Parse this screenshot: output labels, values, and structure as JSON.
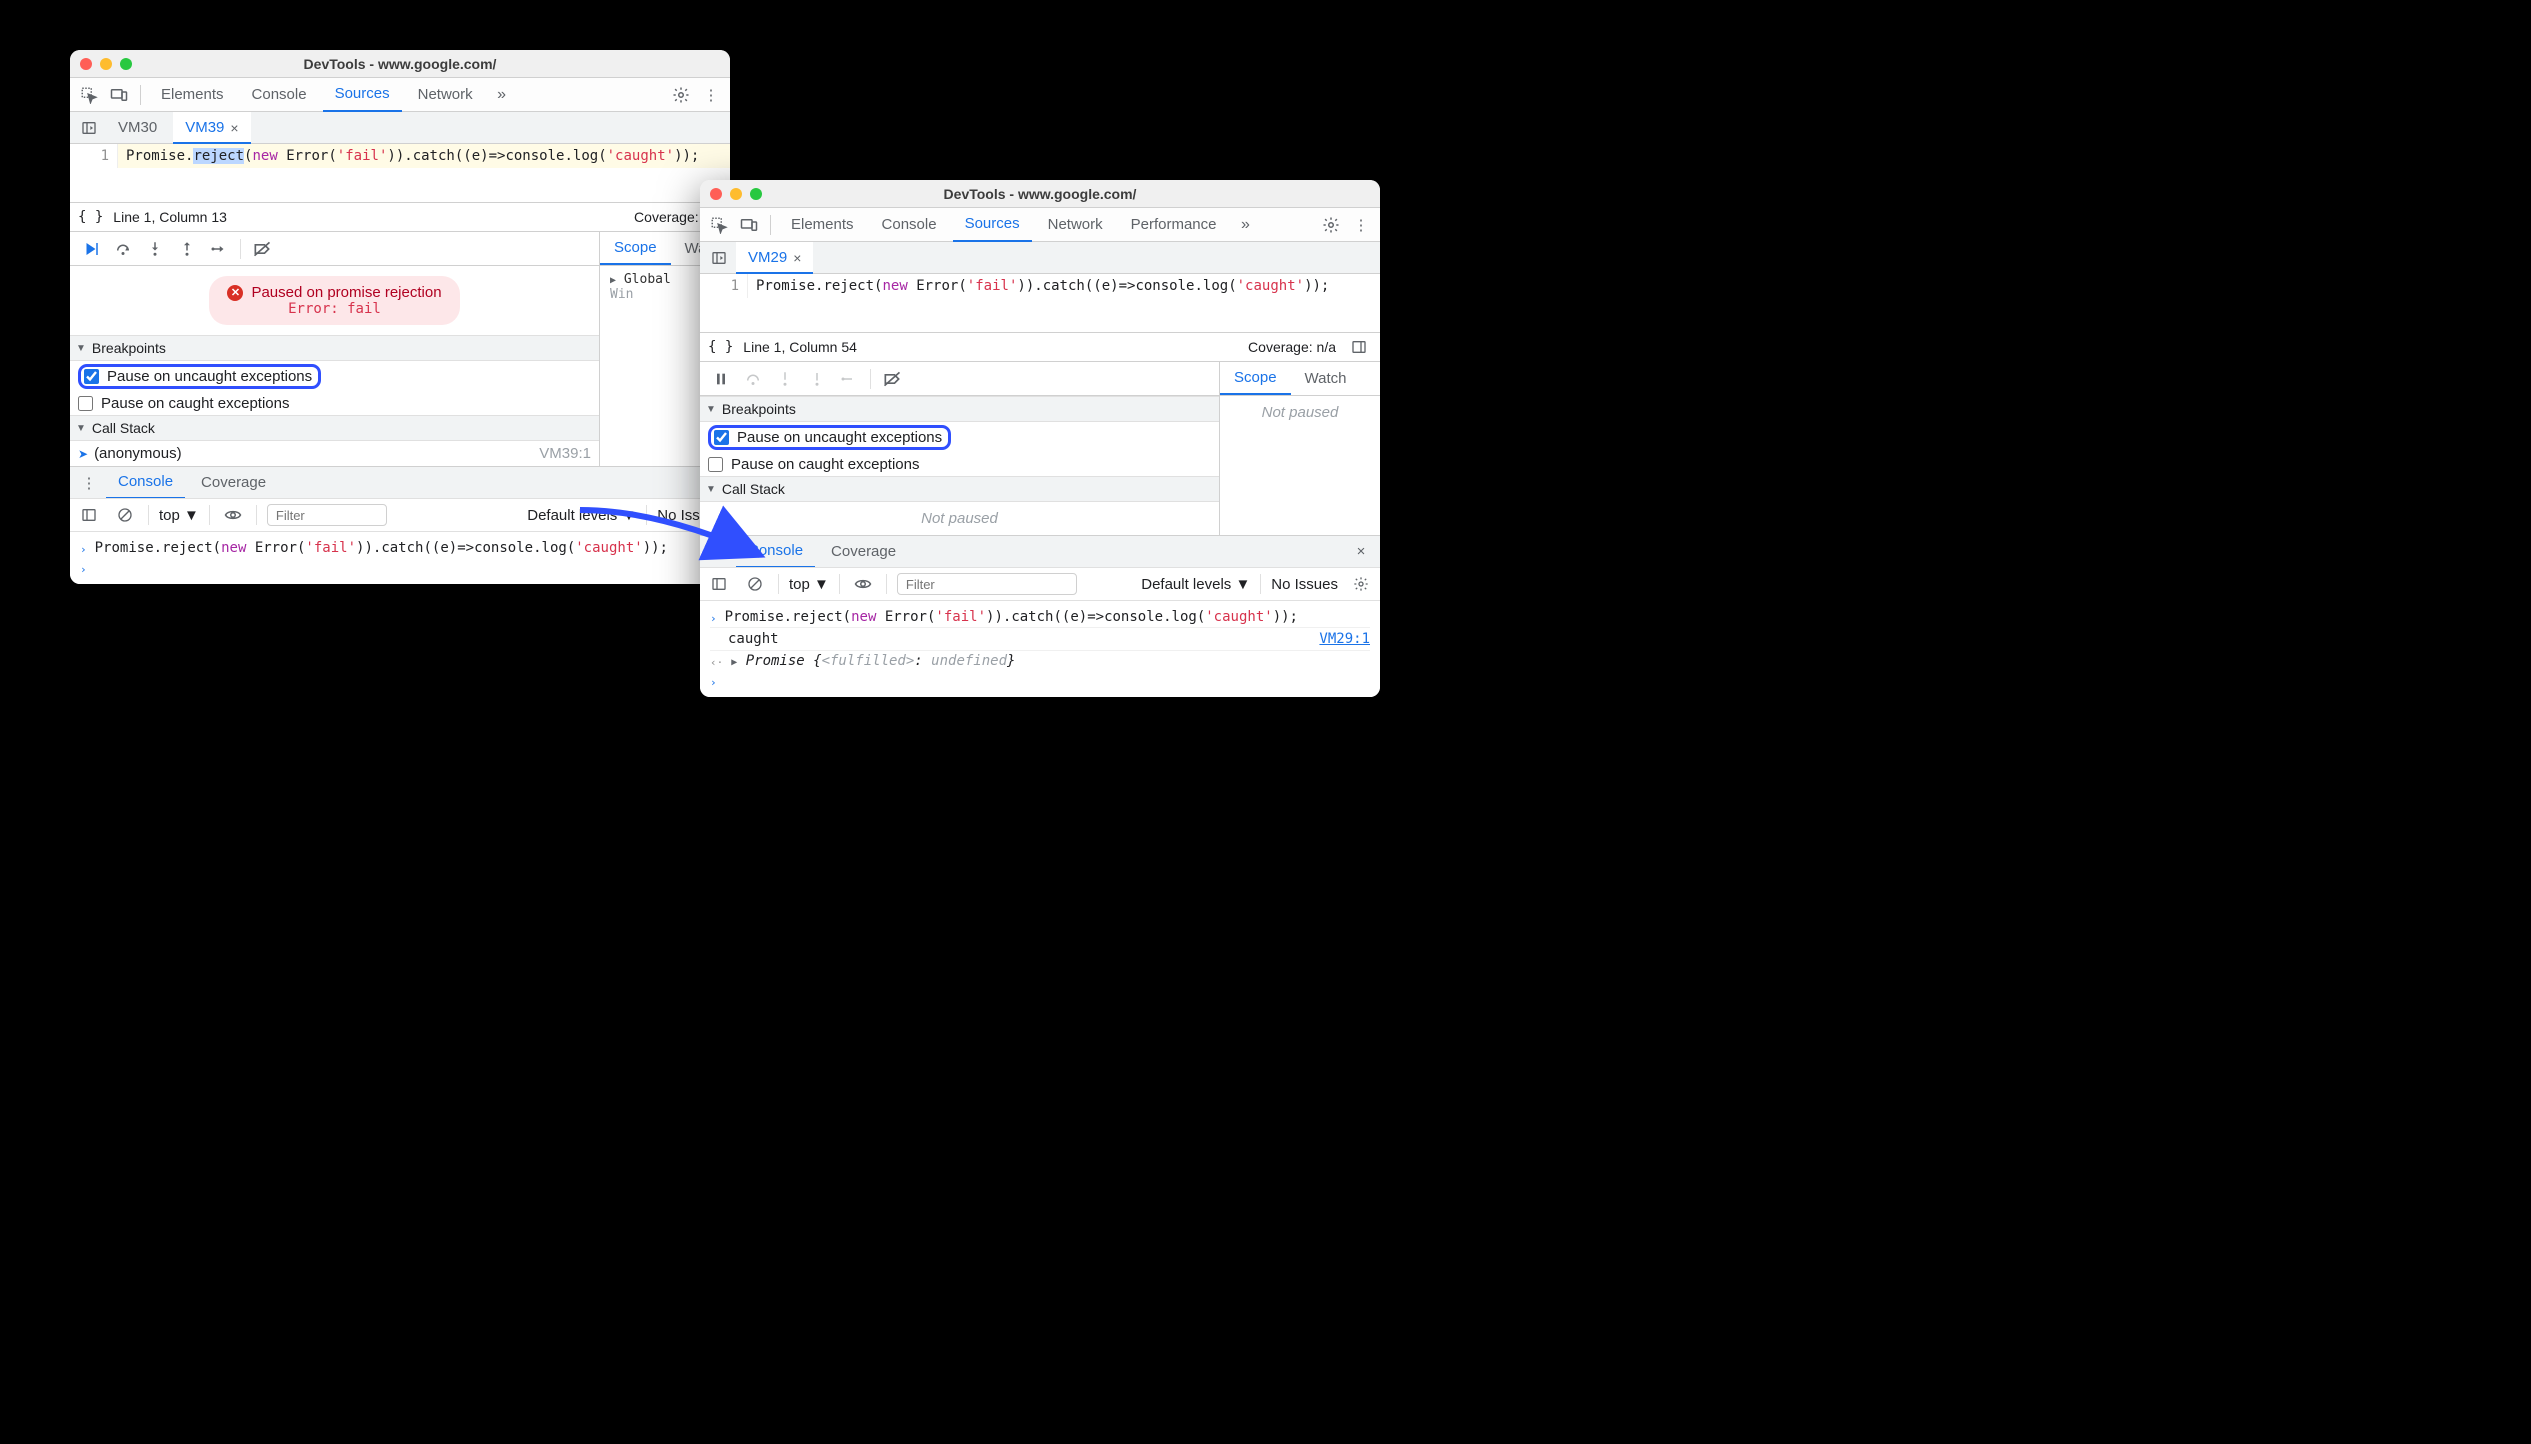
{
  "windowA": {
    "title": "DevTools - www.google.com/",
    "main_tabs": [
      "Elements",
      "Console",
      "Sources",
      "Network"
    ],
    "active_main_tab": "Sources",
    "file_tabs": [
      {
        "name": "VM30",
        "active": false,
        "closeable": false
      },
      {
        "name": "VM39",
        "active": true,
        "closeable": true
      }
    ],
    "code": {
      "line_no": "1",
      "tokens": {
        "promise": "Promise",
        "dot1": ".",
        "reject": "reject",
        "lp1": "(",
        "new": "new",
        "sp1": " ",
        "error": "Error",
        "lp2": "(",
        "str_fail": "'fail'",
        "rp2": ")",
        "rp1": ")",
        "dot2": ".",
        "catch": "catch",
        "lp3": "((",
        "e": "e",
        "arrow": ")=>",
        "console": "console",
        "dot3": ".",
        "log": "log",
        "lp4": "(",
        "str_caught": "'caught'",
        "rp4": "));"
      }
    },
    "status": {
      "pos": "Line 1, Column 13",
      "coverage": "Coverage: n/a"
    },
    "pause_banner": {
      "line1": "Paused on promise rejection",
      "line2": "Error: fail"
    },
    "breakpoints": {
      "header": "Breakpoints",
      "uncaught": "Pause on uncaught exceptions",
      "caught": "Pause on caught exceptions"
    },
    "callstack": {
      "header": "Call Stack",
      "frame_name": "(anonymous)",
      "frame_loc": "VM39:1"
    },
    "scope": {
      "tab_scope": "Scope",
      "tab_watch": "Watch",
      "global": "Global",
      "win": "Win"
    },
    "drawer_tabs": [
      "Console",
      "Coverage"
    ],
    "active_drawer": "Console",
    "console": {
      "context": "top",
      "filter_placeholder": "Filter",
      "levels": "Default levels",
      "issues": "No Issues",
      "input_line": "Promise.reject(new Error('fail')).catch((e)=>console.log('caught'));"
    }
  },
  "windowB": {
    "title": "DevTools - www.google.com/",
    "main_tabs": [
      "Elements",
      "Console",
      "Sources",
      "Network",
      "Performance"
    ],
    "active_main_tab": "Sources",
    "file_tabs": [
      {
        "name": "VM29",
        "active": true,
        "closeable": true
      }
    ],
    "code": {
      "line_no": "1",
      "tokens": {
        "promise": "Promise",
        "dot1": ".",
        "reject": "reject",
        "lp1": "(",
        "new": "new",
        "sp1": " ",
        "error": "Error",
        "lp2": "(",
        "str_fail": "'fail'",
        "rp2": ")",
        "rp1": ")",
        "dot2": ".",
        "catch": "catch",
        "lp3": "((",
        "e": "e",
        "arrow": ")=>",
        "console": "console",
        "dot3": ".",
        "log": "log",
        "lp4": "(",
        "str_caught": "'caught'",
        "rp4": "));"
      }
    },
    "status": {
      "pos": "Line 1, Column 54",
      "coverage": "Coverage: n/a"
    },
    "breakpoints": {
      "header": "Breakpoints",
      "uncaught": "Pause on uncaught exceptions",
      "caught": "Pause on caught exceptions"
    },
    "callstack": {
      "header": "Call Stack",
      "not_paused": "Not paused"
    },
    "scope": {
      "tab_scope": "Scope",
      "tab_watch": "Watch",
      "not_paused": "Not paused"
    },
    "drawer_tabs": [
      "Console",
      "Coverage"
    ],
    "active_drawer": "Console",
    "console": {
      "context": "top",
      "filter_placeholder": "Filter",
      "levels": "Default levels",
      "issues": "No Issues",
      "input_line": "Promise.reject(new Error('fail')).catch((e)=>console.log('caught'));",
      "out_caught": "caught",
      "out_link": "VM29:1",
      "ret_promise": "Promise {",
      "ret_state": "<fulfilled>",
      "ret_colon": ": ",
      "ret_val": "undefined",
      "ret_close": "}"
    }
  }
}
